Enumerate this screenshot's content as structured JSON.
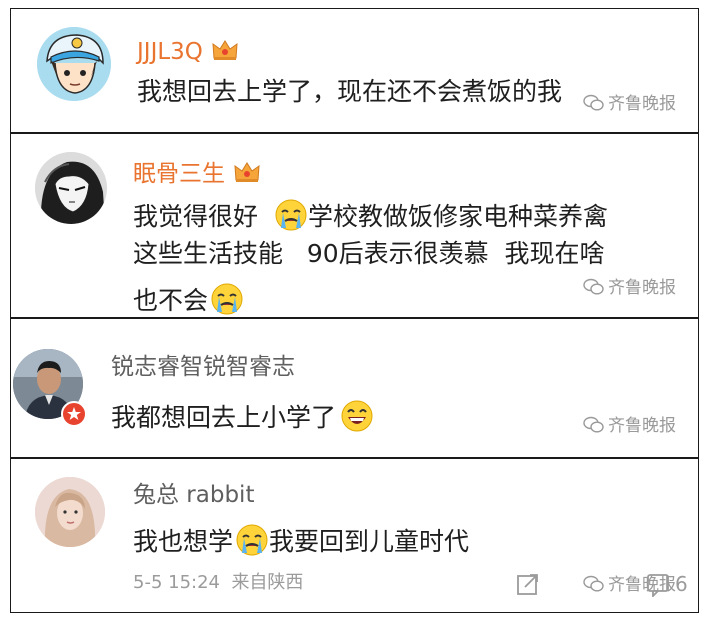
{
  "comments": [
    {
      "username": "JJJL3Q",
      "lines": [
        "我想回去上学了，现在还不会煮饭的我"
      ],
      "watermark": "齐鲁晚报"
    },
    {
      "username": "眠骨三生",
      "lines": [
        "我觉得很好",
        "学校教做饭修家电种菜养禽",
        "这些生活技能   90后表示很羡慕  我现在啥",
        "也不会"
      ],
      "watermark": "齐鲁晚报"
    },
    {
      "username": "锐志睿智锐智睿志",
      "lines": [
        "我都想回去上小学了"
      ],
      "watermark": "齐鲁晚报"
    },
    {
      "username": "兔总 rabbit",
      "lines": [
        "我也想学",
        "我要回到儿童时代"
      ],
      "meta": "5-5 15:24  来自陕西",
      "watermark": "齐鲁晚报",
      "count": "6"
    }
  ],
  "icons": {
    "crown": "crown-icon",
    "crying": "crying-face-icon",
    "laughing": "laughing-face-icon",
    "repost": "repost-icon",
    "comment": "comment-icon",
    "wechat": "wechat-icon"
  },
  "colors": {
    "vip_name": "#e9742f",
    "normal_name": "#5f5f5f",
    "body_text": "#1f1f1f",
    "meta_text": "#9b9b9b",
    "badge_red": "#e8432e"
  }
}
